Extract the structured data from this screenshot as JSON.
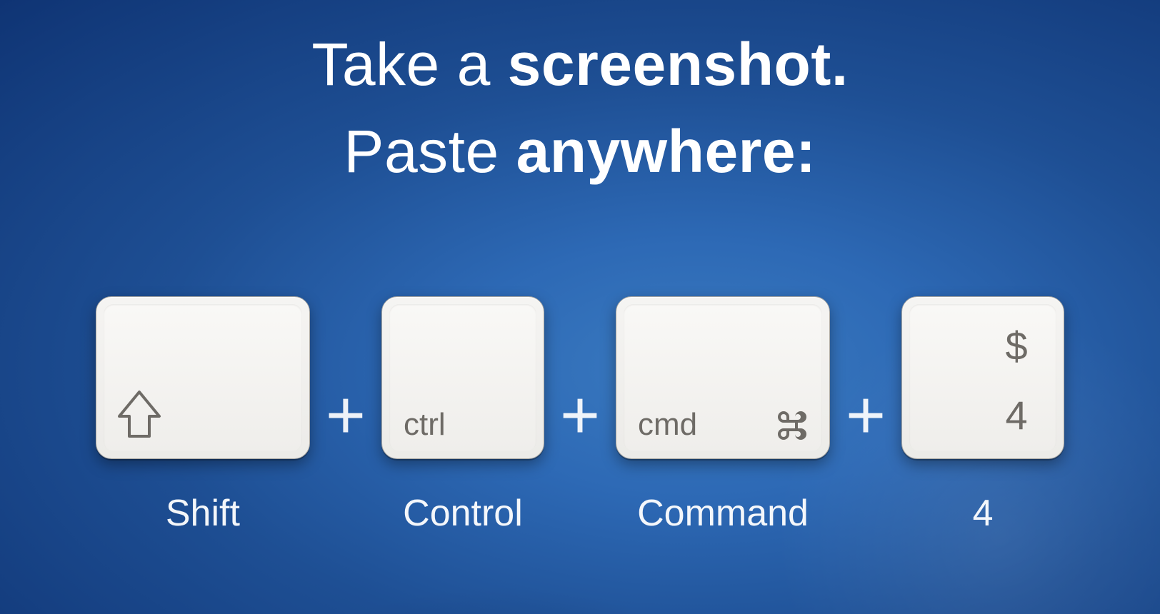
{
  "headline": {
    "line1_prefix": "Take a ",
    "line1_bold": "screenshot.",
    "line2_prefix": "Paste ",
    "line2_bold": "anywhere:"
  },
  "separator": "+",
  "keys": [
    {
      "cap_text": "",
      "below": "Shift",
      "icon": "shift-arrow-icon"
    },
    {
      "cap_text": "ctrl",
      "below": "Control",
      "icon": ""
    },
    {
      "cap_text": "cmd",
      "below": "Command",
      "icon": "command-icon"
    },
    {
      "cap_text": "4",
      "below": "4",
      "secondary": "$"
    }
  ]
}
